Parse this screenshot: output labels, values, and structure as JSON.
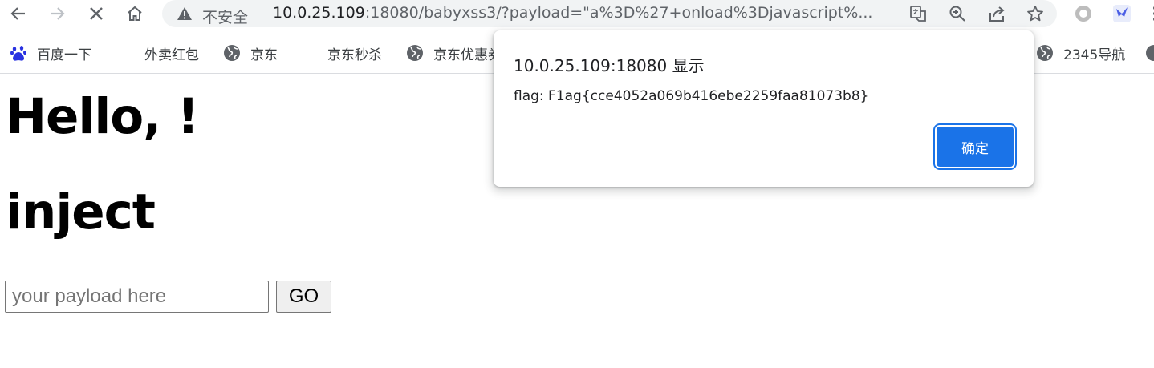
{
  "browser": {
    "omnibox": {
      "security_label": "不安全",
      "url_host": "10.0.25.109",
      "url_rest": ":18080/babyxss3/?payload=\"a%3D%27+onload%3Djavascript%..."
    },
    "bookmarks": [
      {
        "label": "百度一下",
        "icon": "baidu-paw-icon"
      },
      {
        "label": "外卖红包",
        "icon": "none"
      },
      {
        "label": "京东",
        "icon": "globe-icon"
      },
      {
        "label": "京东秒杀",
        "icon": "none"
      },
      {
        "label": "京东优惠券",
        "icon": "globe-icon"
      },
      {
        "label": "2345导航",
        "icon": "globe-icon"
      }
    ],
    "accent_color": "#1a73e8"
  },
  "page": {
    "greeting": "Hello, !",
    "heading": "inject",
    "payload_input": {
      "placeholder": "your payload here",
      "value": ""
    },
    "go_button": "GO"
  },
  "alert": {
    "title": "10.0.25.109:18080 显示",
    "message": "flag: F1ag{cce4052a069b416ebe2259faa81073b8}",
    "ok_button": "确定"
  }
}
